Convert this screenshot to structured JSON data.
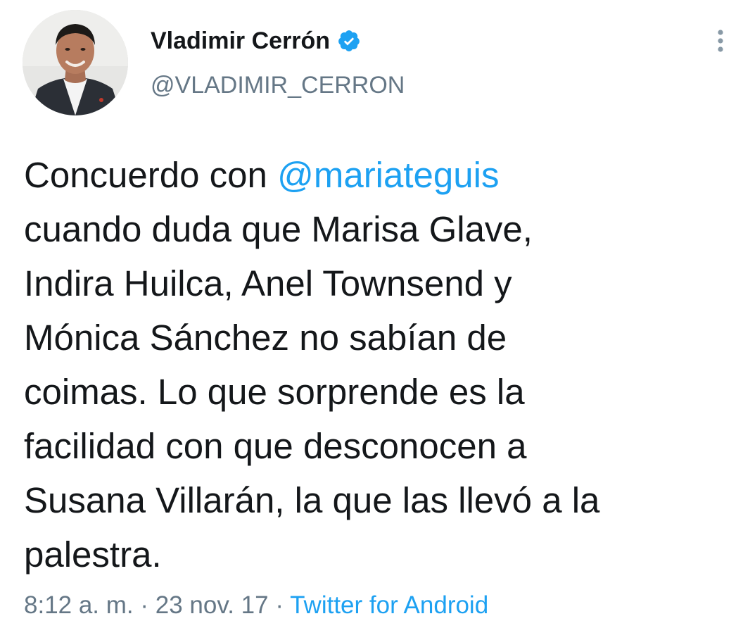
{
  "author": {
    "display_name": "Vladimir Cerrón",
    "handle": "@VLADIMIR_CERRON",
    "verified": true,
    "avatar_icon": "profile-photo"
  },
  "tweet": {
    "lines": [
      {
        "before": "Concuerdo con ",
        "mention": "@mariateguis",
        "after": ""
      },
      {
        "before": "cuando duda que Marisa Glave,",
        "mention": "",
        "after": ""
      },
      {
        "before": "Indira Huilca, Anel Townsend y",
        "mention": "",
        "after": ""
      },
      {
        "before": "Mónica Sánchez no sabían de",
        "mention": "",
        "after": ""
      },
      {
        "before": "coimas. Lo que sorprende es la",
        "mention": "",
        "after": ""
      },
      {
        "before": "facilidad con que desconocen a",
        "mention": "",
        "after": ""
      },
      {
        "before": "Susana Villarán, la que las llevó a la",
        "mention": "",
        "after": ""
      },
      {
        "before": "palestra.",
        "mention": "",
        "after": ""
      }
    ]
  },
  "meta": {
    "time": "8:12 a. m.",
    "separator": " · ",
    "date": "23 nov. 17",
    "source": "Twitter for Android"
  },
  "colors": {
    "accent": "#1da1f2",
    "text": "#14171a",
    "secondary": "#657786"
  },
  "icons": {
    "verified": "verified-badge-icon",
    "more": "more-vertical-icon"
  }
}
